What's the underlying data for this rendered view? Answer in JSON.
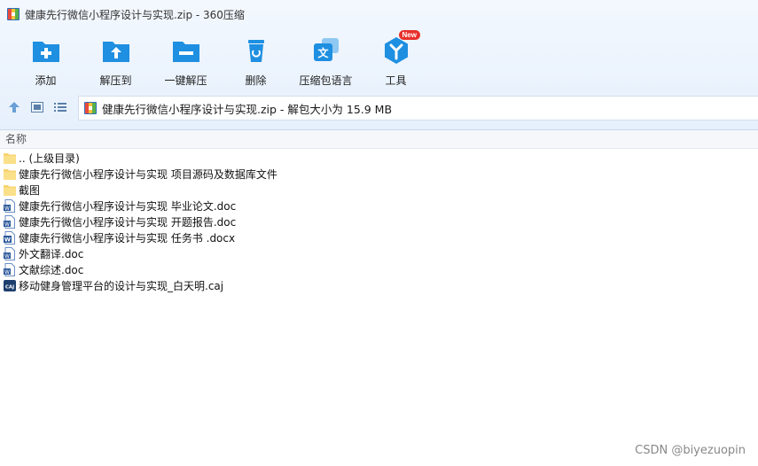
{
  "window": {
    "title": "健康先行微信小程序设计与实现.zip - 360压缩"
  },
  "toolbar": [
    {
      "label": "添加",
      "icon": "add-folder-icon"
    },
    {
      "label": "解压到",
      "icon": "extract-to-icon"
    },
    {
      "label": "一键解压",
      "icon": "one-click-extract-icon"
    },
    {
      "label": "删除",
      "icon": "trash-icon"
    },
    {
      "label": "压缩包语言",
      "icon": "language-icon"
    },
    {
      "label": "工具",
      "icon": "tools-icon",
      "badge": "New"
    }
  ],
  "address": {
    "path": "健康先行微信小程序设计与实现.zip - 解包大小为 15.9 MB"
  },
  "columns": {
    "name": "名称"
  },
  "files": [
    {
      "name": ".. (上级目录)",
      "type": "folder"
    },
    {
      "name": "健康先行微信小程序设计与实现 项目源码及数据库文件",
      "type": "folder"
    },
    {
      "name": "截图",
      "type": "folder"
    },
    {
      "name": "健康先行微信小程序设计与实现 毕业论文.doc",
      "type": "doc"
    },
    {
      "name": "健康先行微信小程序设计与实现 开题报告.doc",
      "type": "doc"
    },
    {
      "name": "健康先行微信小程序设计与实现 任务书 .docx",
      "type": "docx"
    },
    {
      "name": "外文翻译.doc",
      "type": "doc"
    },
    {
      "name": "文献综述.doc",
      "type": "doc"
    },
    {
      "name": "移动健身管理平台的设计与实现_白天明.caj",
      "type": "caj"
    }
  ],
  "watermark": "CSDN @biyezuopin",
  "colors": {
    "accent": "#1e8fe1",
    "folder": "#f7d472",
    "doc": "#2b579a"
  }
}
